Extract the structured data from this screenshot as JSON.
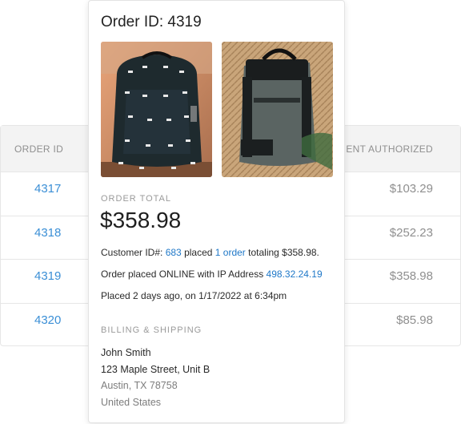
{
  "table": {
    "headers": {
      "order_id": "ORDER ID",
      "payment": "MENT AUTHORIZED"
    },
    "rows": [
      {
        "id": "4317",
        "amount": "$103.29"
      },
      {
        "id": "4318",
        "amount": "$252.23"
      },
      {
        "id": "4319",
        "amount": "$358.98"
      },
      {
        "id": "4320",
        "amount": "$85.98"
      }
    ]
  },
  "popup": {
    "title": "Order ID: 4319",
    "images": [
      {
        "name": "black-patterned-backpack"
      },
      {
        "name": "grey-rolltop-backpack"
      }
    ],
    "order_total_label": "ORDER TOTAL",
    "order_total": "$358.98",
    "customer": {
      "prefix": "Customer ID#: ",
      "id": "683",
      "mid": " placed ",
      "orders_link": "1 order",
      "suffix": " totaling $358.98."
    },
    "ip": {
      "prefix": "Order placed ONLINE with IP Address ",
      "address": "498.32.24.19"
    },
    "placed": "Placed 2 days ago, on 1/17/2022 at 6:34pm",
    "billing_label": "BILLING & SHIPPING",
    "address": {
      "name": "John Smith",
      "street": "123 Maple Street, Unit B",
      "city": "Austin, TX 78758",
      "country": "United States"
    }
  },
  "colors": {
    "link": "#1f78c8",
    "table_link": "#3b8fd6",
    "muted": "#9a9a9a"
  }
}
